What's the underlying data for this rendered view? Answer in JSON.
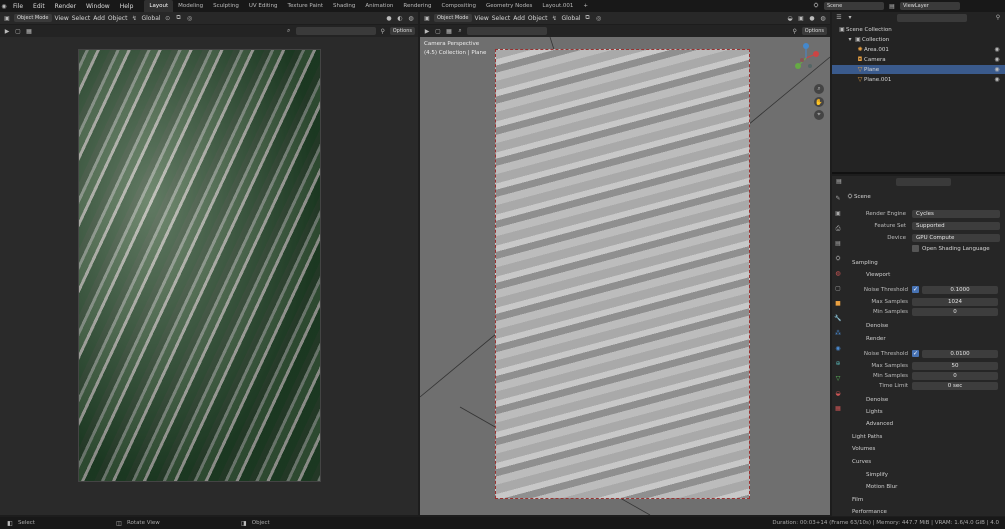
{
  "menu": {
    "items": [
      "File",
      "Edit",
      "Render",
      "Window",
      "Help"
    ]
  },
  "workspaces": [
    "Layout",
    "Modeling",
    "Sculpting",
    "UV Editing",
    "Texture Paint",
    "Shading",
    "Animation",
    "Rendering",
    "Compositing",
    "Geometry Nodes",
    "Layout.001"
  ],
  "scene_name": "Scene",
  "view_layer": "ViewLayer",
  "left_header": {
    "mode": "Object Mode",
    "view": "View",
    "select": "Select",
    "add": "Add",
    "object": "Object",
    "transform": "Global",
    "options": "Options"
  },
  "right_header": {
    "mode": "Object Mode",
    "view": "View",
    "select": "Select",
    "add": "Add",
    "object": "Object",
    "transform": "Global",
    "options": "Options"
  },
  "viewport_info": {
    "line1": "Camera Perspective",
    "line2": "(4.5) Collection | Plane"
  },
  "outliner": {
    "root": "Scene Collection",
    "collection": "Collection",
    "items": [
      {
        "name": "Area.001",
        "type": "light"
      },
      {
        "name": "Camera",
        "type": "camera"
      },
      {
        "name": "Plane",
        "type": "mesh",
        "selected": true
      },
      {
        "name": "Plane.001",
        "type": "mesh"
      }
    ]
  },
  "props": {
    "scene_label": "Scene",
    "render_engine_label": "Render Engine",
    "render_engine": "Cycles",
    "feature_set_label": "Feature Set",
    "feature_set": "Supported",
    "device_label": "Device",
    "device": "GPU Compute",
    "osl_label": "Open Shading Language",
    "sampling": "Sampling",
    "viewport": "Viewport",
    "noise_threshold_label": "Noise Threshold",
    "vp_noise": "0.1000",
    "max_samples_label": "Max Samples",
    "vp_max": "1024",
    "min_samples_label": "Min Samples",
    "vp_min": "0",
    "denoise": "Denoise",
    "render": "Render",
    "r_noise": "0.0100",
    "r_max": "50",
    "r_min": "0",
    "time_limit_label": "Time Limit",
    "time_limit": "0 sec",
    "denoise2": "Denoise",
    "lights": "Lights",
    "advanced": "Advanced",
    "light_paths": "Light Paths",
    "volumes": "Volumes",
    "curves": "Curves",
    "simplify": "Simplify",
    "motion_blur": "Motion Blur",
    "film": "Film",
    "performance": "Performance"
  },
  "status": {
    "select": "Select",
    "rotate": "Rotate View",
    "object": "Object",
    "info": "Duration: 00:03+14 (Frame 63/10s) | Memory: 447.7 MiB | VRAM: 1.6/4.0 GiB | 4.0"
  }
}
